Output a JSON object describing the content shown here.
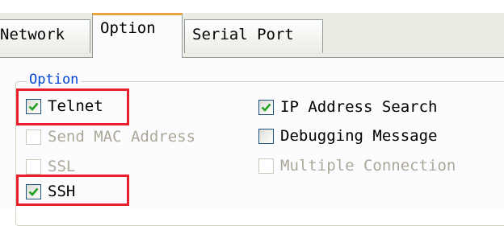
{
  "tabs": [
    {
      "label": "Network",
      "active": false
    },
    {
      "label": "Option",
      "active": true
    },
    {
      "label": "Serial Port",
      "active": false
    }
  ],
  "group": {
    "title": "Option"
  },
  "checkboxes": {
    "telnet": {
      "label": "Telnet",
      "checked": true,
      "enabled": true
    },
    "send_mac": {
      "label": "Send MAC Address",
      "checked": false,
      "enabled": false
    },
    "ssl": {
      "label": "SSL",
      "checked": false,
      "enabled": false
    },
    "ssh": {
      "label": "SSH",
      "checked": true,
      "enabled": true
    },
    "ip_search": {
      "label": "IP Address Search",
      "checked": true,
      "enabled": true
    },
    "debug": {
      "label": "Debugging Message",
      "checked": false,
      "enabled": true
    },
    "multi": {
      "label": "Multiple Connection",
      "checked": false,
      "enabled": false
    }
  },
  "colors": {
    "active_tab_accent": "#e9a43c",
    "group_title": "#0046d5",
    "highlight": "#e8202b",
    "check_mark": "#21a121"
  }
}
